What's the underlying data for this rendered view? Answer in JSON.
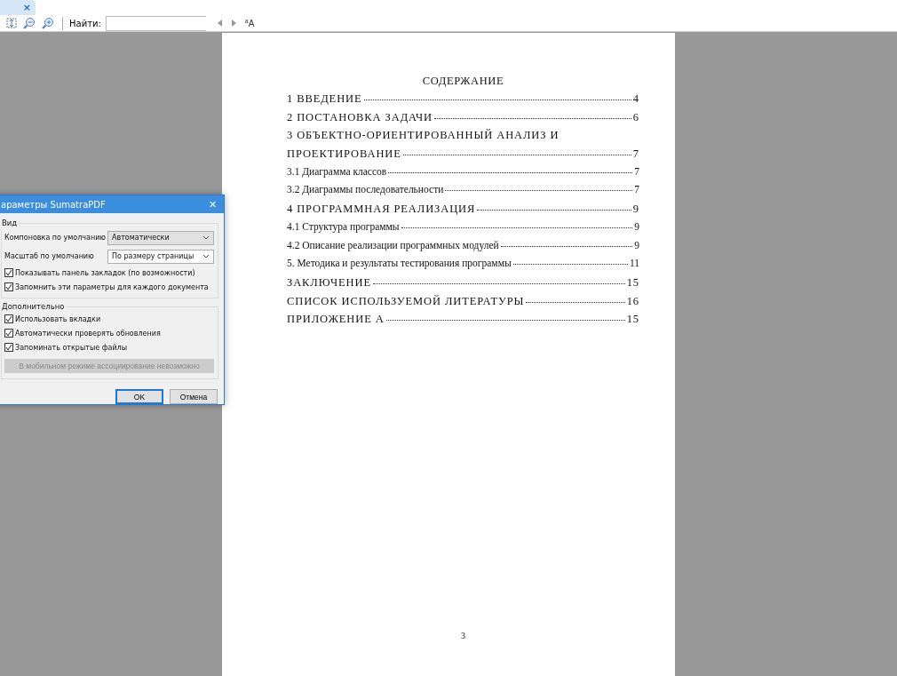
{
  "tabs": [
    {
      "close": "×",
      "selected": true
    }
  ],
  "toolbar": {
    "find_label": "Найти:",
    "match_case": "$^{a}$A"
  },
  "document": {
    "heading": "СОДЕРЖАНИЕ",
    "page_number": "3",
    "toc": [
      {
        "kind": "chapter",
        "title": "1 ВВЕДЕНИЕ",
        "page": "4"
      },
      {
        "kind": "chapter",
        "title": "2 ПОСТАНОВКА ЗАДАЧИ",
        "page": "6"
      },
      {
        "kind": "chapter",
        "title": "3 ОБЪЕКТНО-ОРИЕНТИРОВАННЫЙ АНАЛИЗ И"
      },
      {
        "kind": "chapter",
        "title": "ПРОЕКТИРОВАНИЕ",
        "page": "7"
      },
      {
        "kind": "section",
        "title": "3.1 Диаграмма классов",
        "page": "7"
      },
      {
        "kind": "section",
        "title": "3.2 Диаграммы последовательности",
        "page": "7"
      },
      {
        "kind": "chapter",
        "title": "4 ПРОГРАММНАЯ РЕАЛИЗАЦИЯ",
        "page": "9"
      },
      {
        "kind": "section",
        "title": "4.1 Структура программы",
        "page": "9"
      },
      {
        "kind": "section",
        "title": "4.2 Описание реализации программных модулей",
        "page": "9"
      },
      {
        "kind": "section",
        "title": "5. Методика и результаты тестирования программы",
        "page": "11"
      },
      {
        "kind": "chapter",
        "title": "ЗАКЛЮЧЕНИЕ",
        "page": "15"
      },
      {
        "kind": "chapter",
        "title": "СПИСОК ИСПОЛЬЗУЕМОЙ ЛИТЕРАТУРЫ",
        "page": "16"
      },
      {
        "kind": "chapter",
        "title": "ПРИЛОЖЕНИЕ А",
        "page": "15"
      }
    ]
  },
  "dialog": {
    "title": "араметры SumatraPDF",
    "close": "✕",
    "groups": [
      {
        "label": "Вид",
        "items": [
          {
            "kind": "select",
            "label": "Компоновка по умолчанию",
            "value": "Автоматически",
            "disabled": true
          },
          {
            "kind": "select",
            "label": "Масштаб по умолчанию",
            "value": "По размеру страницы",
            "disabled": false
          },
          {
            "kind": "checkbox",
            "label": "Показывать панель закладок (по возможности)",
            "checked": true
          },
          {
            "kind": "checkbox",
            "label": "Запомнить эти параметры для каждого документа",
            "checked": true
          }
        ]
      },
      {
        "label": "Дополнительно",
        "items": [
          {
            "kind": "checkbox",
            "label": "Использовать вкладки",
            "checked": true
          },
          {
            "kind": "checkbox",
            "label": "Автоматически проверять обновления",
            "checked": true
          },
          {
            "kind": "checkbox",
            "label": "Запоминать открытые файлы",
            "checked": true
          },
          {
            "kind": "button",
            "label": "В мобильном режиме ассоциирование невозможно",
            "disabled": true
          }
        ]
      }
    ],
    "buttons": [
      {
        "label": "OK",
        "default": true
      },
      {
        "label": "Отмена",
        "default": false
      }
    ]
  }
}
